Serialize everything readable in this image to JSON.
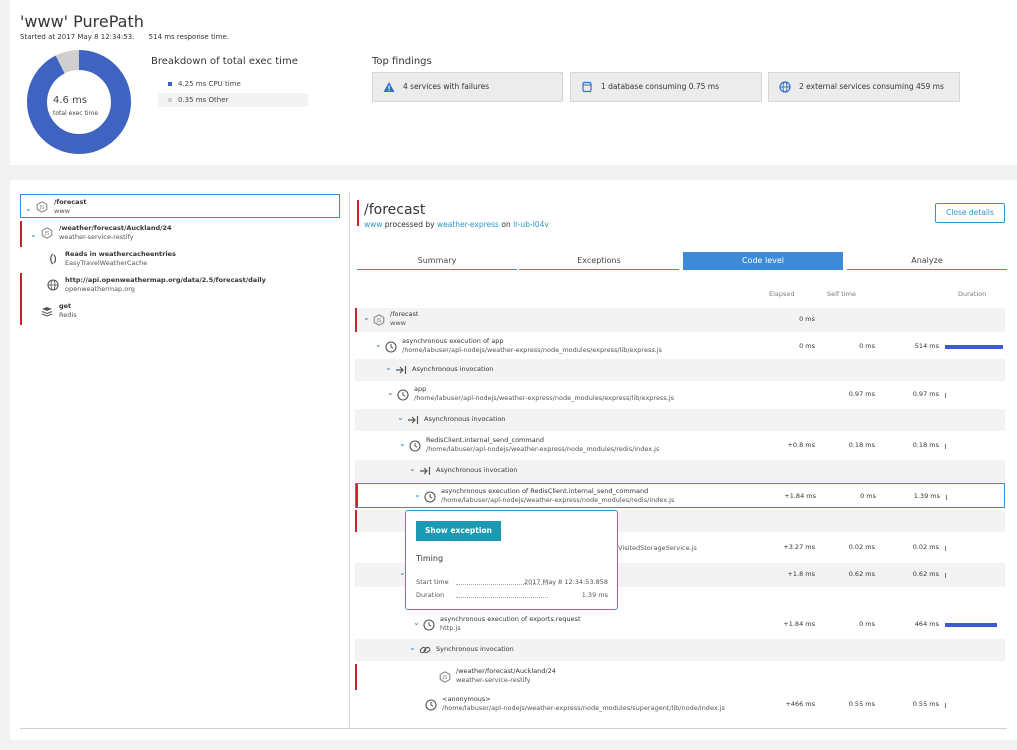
{
  "header": {
    "title": "'www' PurePath",
    "started": "Started at 2017 May 8 12:34:53.",
    "response": "514 ms response time."
  },
  "donut": {
    "value": "4.6 ms",
    "label": "total exec time",
    "cpu_fraction": 0.924,
    "colors": {
      "cpu": "#3e63c1",
      "other": "#cfcfcf"
    }
  },
  "breakdown": {
    "title": "Breakdown of total exec time",
    "items": [
      {
        "label": "4.25 ms CPU time",
        "color": "#3e63c1"
      },
      {
        "label": "0.35 ms Other",
        "color": "#cfcfcf"
      }
    ]
  },
  "findings": {
    "title": "Top findings",
    "items": [
      {
        "label": "4 services with failures",
        "icon": "warning-icon"
      },
      {
        "label": "1 database consuming 0.75 ms",
        "icon": "database-icon"
      },
      {
        "label": "2 external services consuming 459 ms",
        "icon": "globe-icon"
      }
    ]
  },
  "tree": [
    {
      "name": "/forecast",
      "sub": "www"
    },
    {
      "name": "/weather/forecast/Auckland/24",
      "sub": "weather-service-restify"
    },
    {
      "name": "Reads in weathercacheentries",
      "sub": "EasyTravelWeatherCache"
    },
    {
      "name": "http://api.openweathermap.org/data/2.5/forecast/daily",
      "sub": "openweathermap.org"
    },
    {
      "name": "get",
      "sub": "Redis"
    }
  ],
  "details": {
    "title": "/forecast",
    "sub_service": "www",
    "processed_by": "processed by",
    "app": "weather-express",
    "on": "on",
    "host": "lr-ub-l04v",
    "close": "Close details"
  },
  "tabs": [
    {
      "label": "Summary"
    },
    {
      "label": "Exceptions"
    },
    {
      "label": "Code level"
    },
    {
      "label": "Analyze"
    }
  ],
  "columns": {
    "elapsed": "Elapsed",
    "self": "Self time",
    "duration": "Duration"
  },
  "rows": [
    {
      "name": "/forecast",
      "path": "www",
      "elapsed": "0 ms",
      "self": "",
      "duration": "",
      "fraction": 0
    },
    {
      "name": "asynchronous execution of app",
      "path": "/home/labuser/apl-nodejs/weather-express/node_modules/express/lib/express.js",
      "elapsed": "0 ms",
      "self": "0 ms",
      "duration": "514 ms",
      "fraction": 1
    },
    {
      "name": "Asynchronous invocation",
      "path": "",
      "elapsed": "",
      "self": "",
      "duration": "",
      "fraction": 0
    },
    {
      "name": "app",
      "path": "/home/labuser/apl-nodejs/weather-express/node_modules/express/lib/express.js",
      "elapsed": "",
      "self": "0.97 ms",
      "duration": "0.97 ms",
      "fraction": 0.002
    },
    {
      "name": "Asynchronous invocation",
      "path": "",
      "elapsed": "",
      "self": "",
      "duration": "",
      "fraction": 0
    },
    {
      "name": "RedisClient.internal_send_command",
      "path": "/home/labuser/apl-nodejs/weather-express/node_modules/redis/index.js",
      "elapsed": "+0.8 ms",
      "self": "0.18 ms",
      "duration": "0.18 ms",
      "fraction": 0.001
    },
    {
      "name": "Asynchronous invocation",
      "path": "",
      "elapsed": "",
      "self": "",
      "duration": "",
      "fraction": 0
    },
    {
      "name": "asynchronous execution of RedisClient.internal_send_command",
      "path": "/home/labuser/apl-nodejs/weather-express/node_modules/redis/index.js",
      "elapsed": "+1.84 ms",
      "self": "0 ms",
      "duration": "1.39 ms",
      "fraction": 0.003
    },
    {
      "name": "",
      "path": "",
      "elapsed": "",
      "self": "",
      "duration": "",
      "fraction": 0
    },
    {
      "name": "",
      "path": "uslyVisitedStorageService.js",
      "elapsed": "+3.27 ms",
      "self": "0.02 ms",
      "duration": "0.02 ms",
      "fraction": 0.001
    },
    {
      "name": "",
      "path": "",
      "elapsed": "+1.8 ms",
      "self": "0.62 ms",
      "duration": "0.62 ms",
      "fraction": 0.001
    },
    {
      "name": "",
      "path": "",
      "elapsed": "",
      "self": "",
      "duration": "",
      "fraction": 0
    },
    {
      "name": "asynchronous execution of exports.request",
      "path": "http.js",
      "elapsed": "+1.84 ms",
      "self": "0 ms",
      "duration": "464 ms",
      "fraction": 0.9
    },
    {
      "name": "Synchronous invocation",
      "path": "",
      "elapsed": "",
      "self": "",
      "duration": "",
      "fraction": 0
    },
    {
      "name": "/weather/forecast/Auckland/24",
      "path": "weather-service-restify",
      "elapsed": "",
      "self": "",
      "duration": "",
      "fraction": 0
    },
    {
      "name": "<anonymous>",
      "path": "/home/labuser/apl-nodejs/weather-express/node_modules/superagent/lib/node/index.js",
      "elapsed": "+466 ms",
      "self": "0.55 ms",
      "duration": "0.55 ms",
      "fraction": 0.001
    }
  ],
  "popover": {
    "button": "Show exception",
    "heading": "Timing",
    "start_label": "Start time",
    "start_value": "2017 May 8 12:34:53.858",
    "duration_label": "Duration",
    "duration_value": "1.39 ms"
  }
}
